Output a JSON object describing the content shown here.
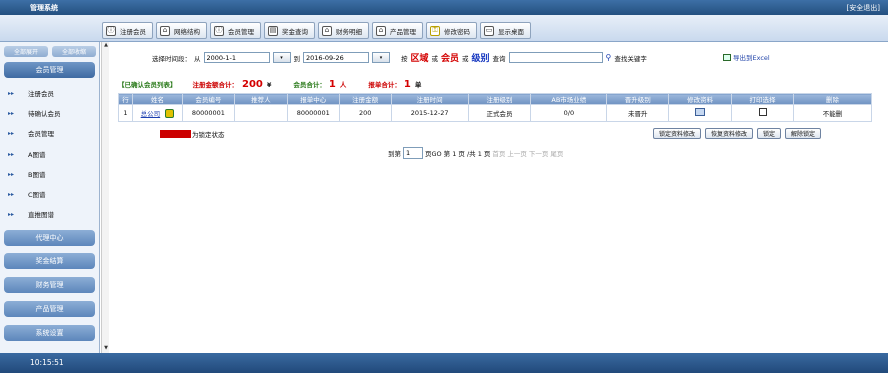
{
  "app": {
    "title": "管理系统",
    "logout_label": "[安全退出]"
  },
  "toolbar": {
    "items": [
      {
        "label": "注册会员",
        "icon": "register-icon"
      },
      {
        "label": "网络结构",
        "icon": "network-icon"
      },
      {
        "label": "会员管理",
        "icon": "member-manage-icon"
      },
      {
        "label": "奖金查询",
        "icon": "bonus-icon"
      },
      {
        "label": "财务明细",
        "icon": "finance-icon"
      },
      {
        "label": "产品管理",
        "icon": "product-icon"
      },
      {
        "label": "修改密码",
        "icon": "password-icon"
      },
      {
        "label": "显示桌面",
        "icon": "desktop-icon"
      }
    ]
  },
  "sidebar": {
    "toggle_expand": "全部展开",
    "toggle_collapse": "全部收缩",
    "active_group": "会员管理",
    "items": [
      "注册会员",
      "待确认会员",
      "会员管理",
      "A图谱",
      "B图谱",
      "C图谱",
      "直推图谱"
    ],
    "groups": [
      "代理中心",
      "奖金结算",
      "财务管理",
      "产品管理",
      "系统设置"
    ]
  },
  "filter": {
    "time_label": "选择时间段：",
    "from_label": "从",
    "from_value": "2000-1-1",
    "to_label": "到",
    "to_value": "2016-09-26",
    "by_prefix": "按",
    "by_region": "区域",
    "or1": "或",
    "by_member": "会员",
    "or2": "或",
    "by_level": "级别",
    "query_suffix": "查询",
    "search_value": "",
    "search_button": "查找关键字",
    "export_label": "导出到Excel"
  },
  "summary": {
    "list_title": "【已确认会员列表】",
    "reg_total_label": "注册金额合计：",
    "reg_total_value": "200",
    "reg_unit": "¥",
    "member_total_label": "会员合计：",
    "member_total_value": "1",
    "member_unit": "人",
    "order_total_label": "报单合计：",
    "order_total_value": "1",
    "order_unit": "单"
  },
  "table": {
    "columns": [
      "行",
      "姓名",
      "会员编号",
      "推荐人",
      "报单中心",
      "注册金额",
      "注册时间",
      "注册级别",
      "AB市场业绩",
      "晋升级别",
      "修改资料",
      "打印选择",
      "删除"
    ],
    "rows": [
      {
        "row": "1",
        "name": "总公司",
        "member_no": "80000001",
        "referrer": "",
        "center": "80000001",
        "amount": "200",
        "time": "2015-12-27",
        "level": "正式会员",
        "ab": "0/0",
        "promotion": "未晋升",
        "delete": "不能删"
      }
    ]
  },
  "legend": {
    "text": "为锁定状态",
    "swatch_label": "红色"
  },
  "actions": [
    "锁定资料修改",
    "恢复资料修改",
    "锁定",
    "解除锁定"
  ],
  "pager": {
    "to_label": "到第",
    "page_value": "1",
    "go_label": "页GO",
    "current": "第 1 页",
    "total": "/共 1 页",
    "first": "首页",
    "prev": "上一页",
    "next": "下一页",
    "last": "尾页"
  },
  "status": {
    "clock": "10:15:51"
  },
  "colors": {
    "accent": "#2a5aa0",
    "titlebar": "#24507f",
    "header": "#6f92c2",
    "highlight_red": "#d40000"
  }
}
